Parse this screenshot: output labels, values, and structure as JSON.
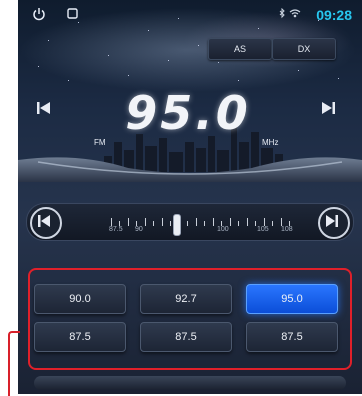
{
  "status": {
    "time": "09:28",
    "signal_text": "✱ ⁺⁎",
    "power_icon": "power-icon",
    "window_icon": "recent-apps-icon"
  },
  "controls": {
    "as_label": "AS",
    "dx_label": "DX"
  },
  "display": {
    "frequency": "95.0",
    "band": "FM",
    "unit": "MHz"
  },
  "scale": {
    "labels": [
      "87.5",
      "90",
      "100",
      "105",
      "108"
    ],
    "current_frequency": 95.0
  },
  "presets": [
    {
      "label": "90.0",
      "active": false
    },
    {
      "label": "92.7",
      "active": false
    },
    {
      "label": "95.0",
      "active": true
    },
    {
      "label": "87.5",
      "active": false
    },
    {
      "label": "87.5",
      "active": false
    },
    {
      "label": "87.5",
      "active": false
    }
  ],
  "colors": {
    "accent": "#27c6ee",
    "active_preset": "#1a62f0",
    "highlight_box": "#e0202a"
  }
}
